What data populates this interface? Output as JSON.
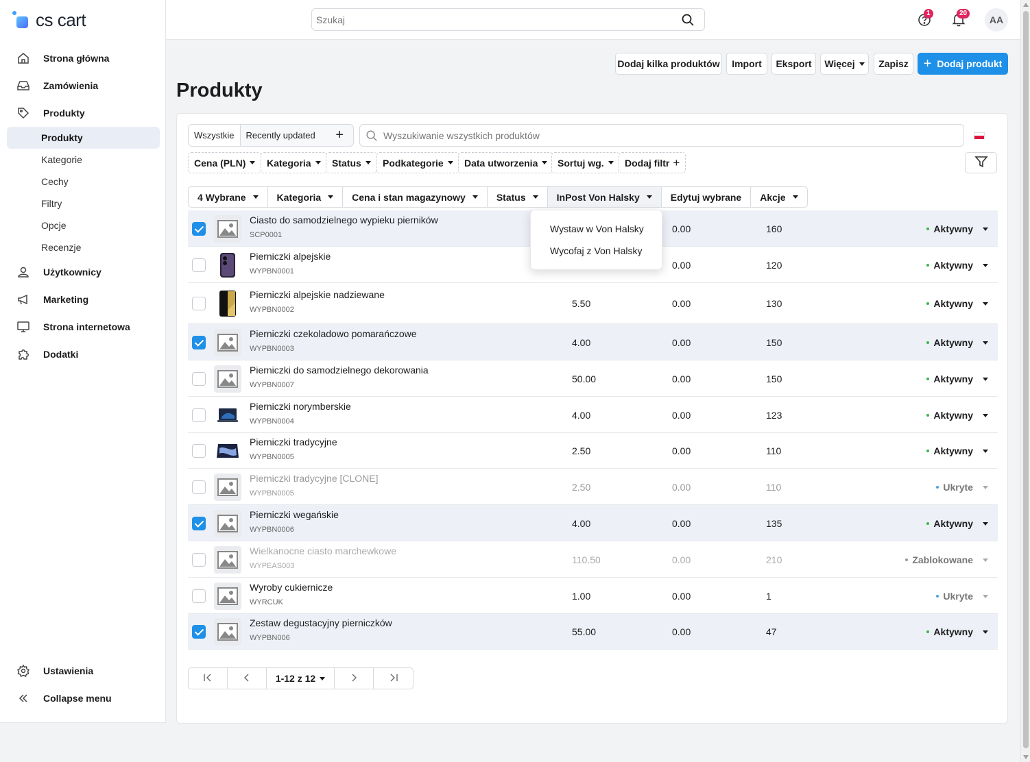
{
  "app": {
    "logo_text": "cs cart"
  },
  "header": {
    "search_placeholder": "Szukaj",
    "help_badge": "1",
    "notif_badge": "20",
    "avatar": "AA"
  },
  "sidebar": {
    "items": [
      {
        "label": "Strona główna"
      },
      {
        "label": "Zamówienia"
      },
      {
        "label": "Produkty"
      },
      {
        "label": "Użytkownicy"
      },
      {
        "label": "Marketing"
      },
      {
        "label": "Strona internetowa"
      },
      {
        "label": "Dodatki"
      }
    ],
    "subitems": [
      {
        "label": "Produkty"
      },
      {
        "label": "Kategorie"
      },
      {
        "label": "Cechy"
      },
      {
        "label": "Filtry"
      },
      {
        "label": "Opcje"
      },
      {
        "label": "Recenzje"
      }
    ],
    "settings": "Ustawienia",
    "collapse": "Collapse menu"
  },
  "toolbar": {
    "add_many": "Dodaj kilka produktów",
    "import": "Import",
    "export": "Eksport",
    "more": "Więcej",
    "save": "Zapisz",
    "add_product": "Dodaj produkt"
  },
  "page": {
    "title": "Produkty"
  },
  "tabs": {
    "all": "Wszystkie",
    "recent": "Recently updated"
  },
  "product_search": {
    "placeholder": "Wyszukiwanie wszystkich produktów"
  },
  "filters": [
    "Cena (PLN)",
    "Kategoria",
    "Status",
    "Podkategorie",
    "Data utworzenia",
    "Sortuj wg."
  ],
  "add_filter": "Dodaj filtr",
  "bulk": {
    "selected": "4 Wybrane",
    "category": "Kategoria",
    "price_stock": "Cena i stan magazynowy",
    "status": "Status",
    "inpost": "InPost Von Halsky",
    "edit": "Edytuj wybrane",
    "actions": "Akcje"
  },
  "dropdown": {
    "item1": "Wystaw w Von Halsky",
    "item2": "Wycofaj z Von Halsky"
  },
  "products": [
    {
      "name": "Ciasto do samodzielnego wypieku pierników",
      "code": "SCP0001",
      "price": "",
      "list": "0.00",
      "qty": "160",
      "status": "Aktywny"
    },
    {
      "name": "Pierniczki alpejskie",
      "code": "WYPBN0001",
      "price": "",
      "list": "0.00",
      "qty": "120",
      "status": "Aktywny"
    },
    {
      "name": "Pierniczki alpejskie nadziewane",
      "code": "WYPBN0002",
      "price": "5.50",
      "list": "0.00",
      "qty": "130",
      "status": "Aktywny"
    },
    {
      "name": "Pierniczki czekoladowo pomarańczowe",
      "code": "WYPBN0003",
      "price": "4.00",
      "list": "0.00",
      "qty": "150",
      "status": "Aktywny"
    },
    {
      "name": "Pierniczki do samodzielnego dekorowania",
      "code": "WYPBN0007",
      "price": "50.00",
      "list": "0.00",
      "qty": "150",
      "status": "Aktywny"
    },
    {
      "name": "Pierniczki norymberskie",
      "code": "WYPBN0004",
      "price": "4.00",
      "list": "0.00",
      "qty": "123",
      "status": "Aktywny"
    },
    {
      "name": "Pierniczki tradycyjne",
      "code": "WYPBN0005",
      "price": "2.50",
      "list": "0.00",
      "qty": "110",
      "status": "Aktywny"
    },
    {
      "name": "Pierniczki tradycyjne [CLONE]",
      "code": "WYPBN0005",
      "price": "2.50",
      "list": "0.00",
      "qty": "110",
      "status": "Ukryte"
    },
    {
      "name": "Pierniczki wegańskie",
      "code": "WYPBN0006",
      "price": "4.00",
      "list": "0.00",
      "qty": "135",
      "status": "Aktywny"
    },
    {
      "name": "Wielkanocne ciasto marchewkowe",
      "code": "WYPEAS003",
      "price": "110.50",
      "list": "0.00",
      "qty": "210",
      "status": "Zablokowane"
    },
    {
      "name": "Wyroby cukiernicze",
      "code": "WYRCUK",
      "price": "1.00",
      "list": "0.00",
      "qty": "1",
      "status": "Ukryte"
    },
    {
      "name": "Zestaw degustacyjny pierniczków",
      "code": "WYPBN006",
      "price": "55.00",
      "list": "0.00",
      "qty": "47",
      "status": "Aktywny"
    }
  ],
  "pagination": {
    "range": "1-12 z 12"
  },
  "colors": {
    "primary": "#1e90e8",
    "active_dot": "#3bb54a",
    "hidden_dot": "#4aa3df",
    "blocked_dot": "#999999"
  }
}
